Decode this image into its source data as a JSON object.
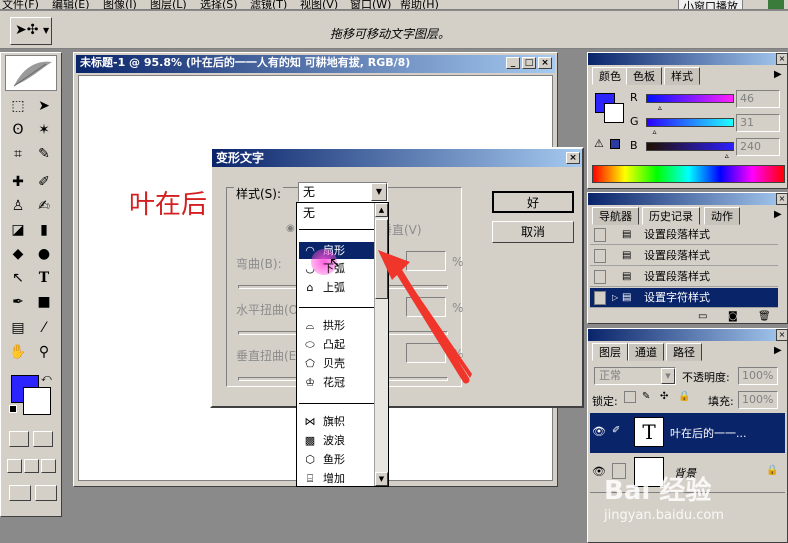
{
  "menubar": {
    "items": [
      "文件(F)",
      "编辑(E)",
      "图像(I)",
      "图层(L)",
      "选择(S)",
      "滤镜(T)",
      "视图(V)",
      "窗口(W)",
      "帮助(H)"
    ],
    "right_buttons": [
      "小窗口播放"
    ]
  },
  "options_bar": {
    "hint": "拖移可移动文字图层。"
  },
  "document": {
    "title": "未标题-1 @ 95.8% (叶在后的一一人有的知 可耕地有拔, RGB/8)",
    "canvas_text": "叶在后"
  },
  "color_panel": {
    "tabs": [
      "颜色",
      "色板",
      "样式"
    ],
    "channels": [
      {
        "label": "R",
        "value": "46",
        "level": 0.18,
        "gradient": "#2e1fff"
      },
      {
        "label": "G",
        "value": "31",
        "level": 0.12,
        "gradient": "#2e1fff"
      },
      {
        "label": "B",
        "value": "240",
        "level": 0.94,
        "gradient": "#2e1fff"
      }
    ],
    "foreground": "#2b24ff"
  },
  "history_panel": {
    "tabs": [
      "导航器",
      "历史记录",
      "动作"
    ],
    "rows": [
      "设置段落样式",
      "设置段落样式",
      "设置段落样式",
      "设置字符样式"
    ],
    "selected_index": 3
  },
  "layers_panel": {
    "tabs": [
      "图层",
      "通道",
      "路径"
    ],
    "blend_mode": "正常",
    "opacity_label": "不透明度:",
    "opacity": "100%",
    "lock_label": "锁定:",
    "fill_label": "填充:",
    "fill": "100%",
    "layers": [
      {
        "name": "叶在后的一一...",
        "selected": true,
        "thumb": "T"
      },
      {
        "name": "背景",
        "selected": false,
        "thumb": ""
      }
    ]
  },
  "warp_dialog": {
    "title": "变形文字",
    "style_label": "样式(S):",
    "style_value": "无",
    "ok_label": "好",
    "cancel_label": "取消",
    "vertical_label": "垂直(V)",
    "bend_label": "弯曲(B):",
    "h_distort_label": "水平扭曲(O):",
    "v_distort_label": "垂直扭曲(E):",
    "percent": "%"
  },
  "dropdown": {
    "items": [
      {
        "label": "无",
        "icon": ""
      },
      {
        "label": "扇形",
        "icon": "fan-shape-icon",
        "selected": true
      },
      {
        "label": "下弧",
        "icon": "lower-arc-icon"
      },
      {
        "label": "上弧",
        "icon": "upper-arc-icon"
      },
      {
        "label": "拱形",
        "icon": "arch-icon"
      },
      {
        "label": "凸起",
        "icon": "bulge-icon"
      },
      {
        "label": "贝壳",
        "icon": "shell-icon"
      },
      {
        "label": "花冠",
        "icon": "flower-crown-icon"
      },
      {
        "label": "旗帜",
        "icon": "flag-icon"
      },
      {
        "label": "波浪",
        "icon": "wave-icon"
      },
      {
        "label": "鱼形",
        "icon": "fish-icon"
      },
      {
        "label": "增加",
        "icon": "rise-icon"
      }
    ]
  },
  "watermark": {
    "brand": "Bai 经验",
    "url": "jingyan.baidu.com"
  }
}
